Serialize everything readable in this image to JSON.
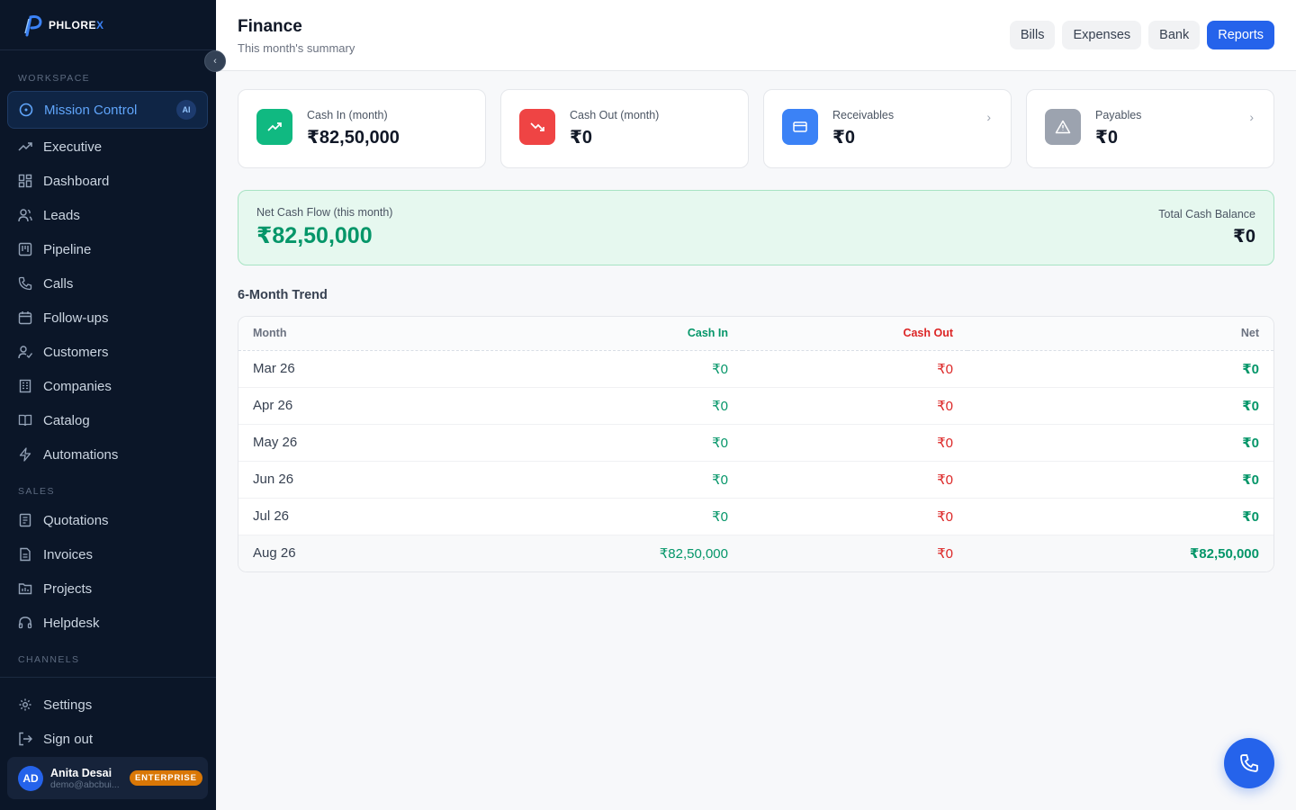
{
  "brand": {
    "name": "PHLORE",
    "suffix": "X"
  },
  "sidebar": {
    "sections": {
      "workspace": "WORKSPACE",
      "sales": "SALES",
      "channels": "CHANNELS"
    },
    "items": [
      {
        "label": "Mission Control",
        "badge": "AI",
        "icon": "target-icon"
      },
      {
        "label": "Executive",
        "icon": "trending-icon"
      },
      {
        "label": "Dashboard",
        "icon": "grid-icon"
      },
      {
        "label": "Leads",
        "icon": "users-icon"
      },
      {
        "label": "Pipeline",
        "icon": "kanban-icon"
      },
      {
        "label": "Calls",
        "icon": "phone-icon"
      },
      {
        "label": "Follow-ups",
        "icon": "calendar-icon"
      },
      {
        "label": "Customers",
        "icon": "user-check-icon"
      },
      {
        "label": "Companies",
        "icon": "building-icon"
      },
      {
        "label": "Catalog",
        "icon": "book-icon"
      },
      {
        "label": "Automations",
        "icon": "bolt-icon"
      },
      {
        "label": "Quotations",
        "icon": "receipt-icon"
      },
      {
        "label": "Invoices",
        "icon": "file-icon"
      },
      {
        "label": "Projects",
        "icon": "folder-icon"
      },
      {
        "label": "Helpdesk",
        "icon": "headset-icon"
      }
    ],
    "footer": {
      "settings": "Settings",
      "signout": "Sign out"
    },
    "user": {
      "initials": "AD",
      "name": "Anita Desai",
      "email": "demo@abcbui...",
      "plan": "ENTERPRISE"
    }
  },
  "header": {
    "title": "Finance",
    "subtitle": "This month's summary",
    "buttons": [
      "Bills",
      "Expenses",
      "Bank",
      "Reports"
    ]
  },
  "cards": [
    {
      "label": "Cash In (month)",
      "value": "₹82,50,000",
      "color": "#10b981"
    },
    {
      "label": "Cash Out (month)",
      "value": "₹0",
      "color": "#ef4444"
    },
    {
      "label": "Receivables",
      "value": "₹0",
      "color": "#3b82f6"
    },
    {
      "label": "Payables",
      "value": "₹0",
      "color": "#9ca3af"
    }
  ],
  "netflow": {
    "label": "Net Cash Flow (this month)",
    "value": "₹82,50,000",
    "balance_label": "Total Cash Balance",
    "balance_value": "₹0"
  },
  "trend": {
    "title": "6-Month Trend",
    "headers": [
      "Month",
      "Cash In",
      "Cash Out",
      "Net"
    ],
    "rows": [
      {
        "month": "Mar 26",
        "cin": "₹0",
        "cout": "₹0",
        "net": "₹0"
      },
      {
        "month": "Apr 26",
        "cin": "₹0",
        "cout": "₹0",
        "net": "₹0"
      },
      {
        "month": "May 26",
        "cin": "₹0",
        "cout": "₹0",
        "net": "₹0"
      },
      {
        "month": "Jun 26",
        "cin": "₹0",
        "cout": "₹0",
        "net": "₹0"
      },
      {
        "month": "Jul 26",
        "cin": "₹0",
        "cout": "₹0",
        "net": "₹0"
      },
      {
        "month": "Aug 26",
        "cin": "₹82,50,000",
        "cout": "₹0",
        "net": "₹82,50,000"
      }
    ]
  }
}
